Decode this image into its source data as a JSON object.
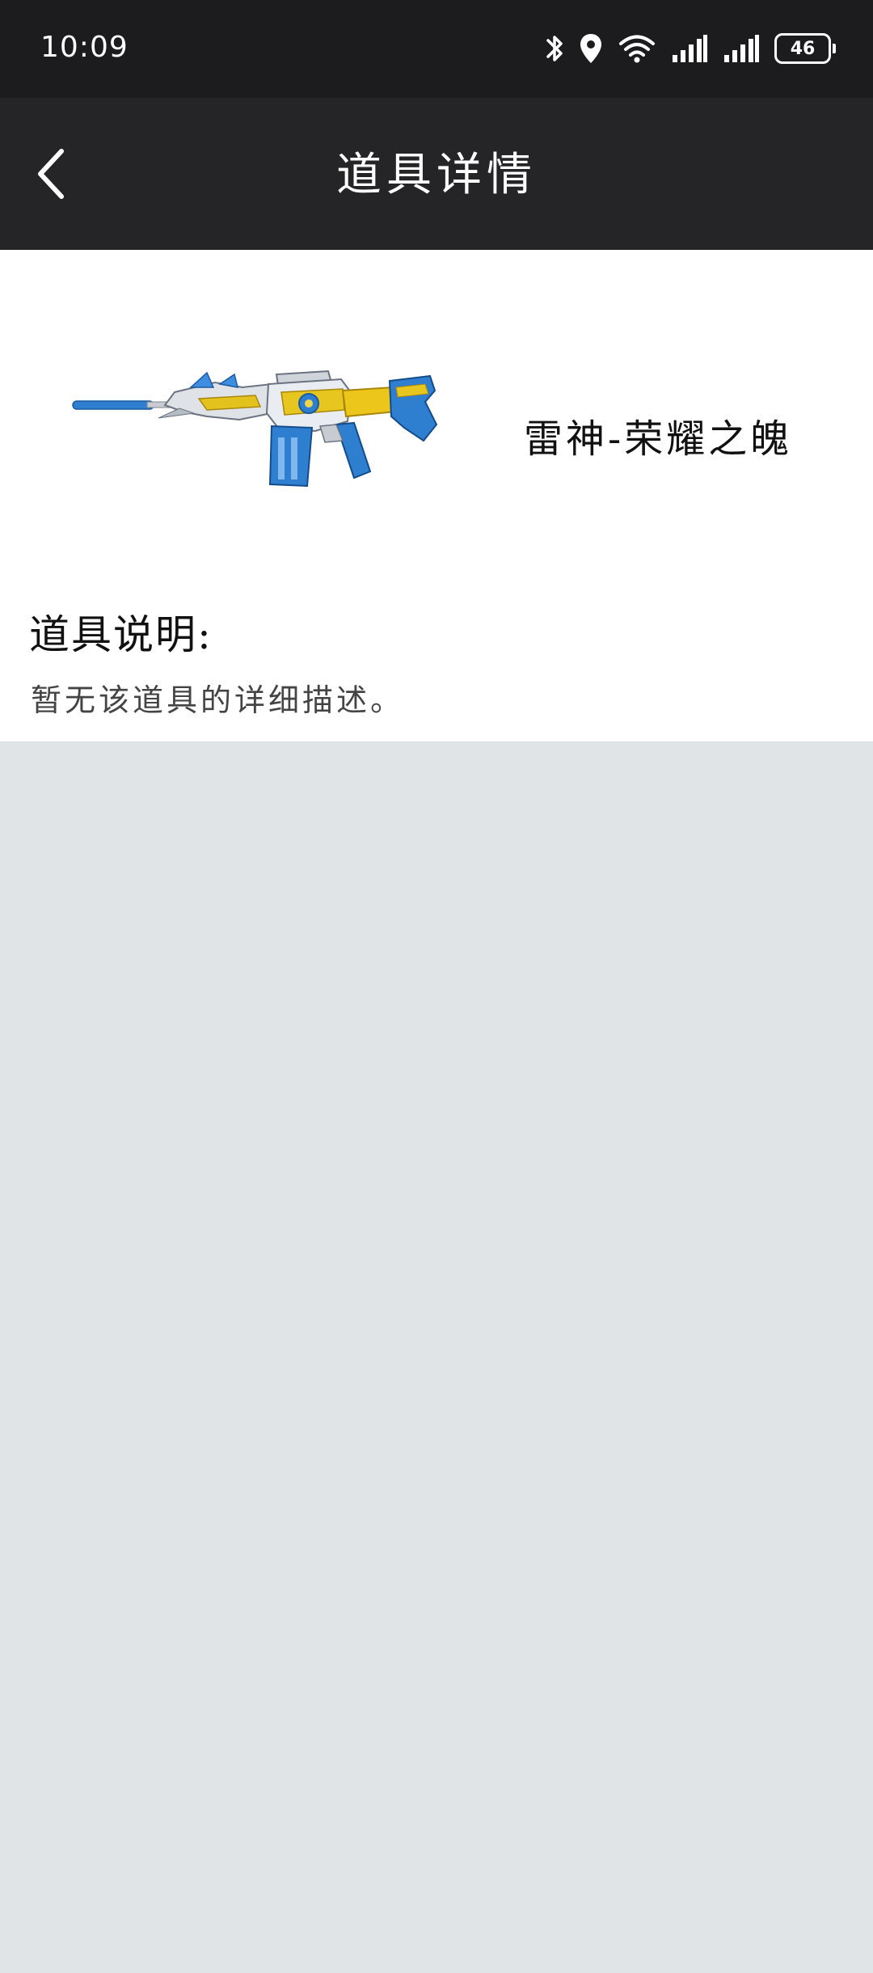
{
  "status_bar": {
    "time": "10:09",
    "battery": "46",
    "icons": [
      "bluetooth-icon",
      "location-icon",
      "wifi-icon",
      "signal-icon",
      "signal-icon",
      "battery-icon"
    ]
  },
  "app_bar": {
    "title": "道具详情",
    "back_icon": "chevron-left-icon"
  },
  "item": {
    "name": "雷神-荣耀之魄",
    "image_icon": "rifle-image"
  },
  "description": {
    "heading": "道具说明:",
    "text": "暂无该道具的详细描述。"
  },
  "colors": {
    "status_bar_bg": "#1c1c1e",
    "app_bar_bg": "#252528",
    "content_bg": "#ffffff",
    "page_bg": "#e1e4e7"
  }
}
